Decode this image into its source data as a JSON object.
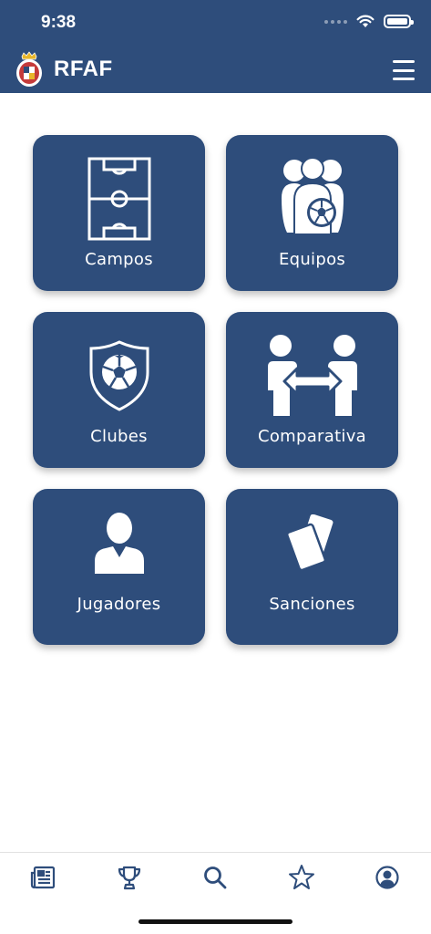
{
  "status_bar": {
    "time": "9:38"
  },
  "header": {
    "title": "RFAF",
    "logo_icon": "federation-crest-icon",
    "menu_icon": "hamburger-menu-icon"
  },
  "tiles": [
    {
      "label": "Campos",
      "icon": "football-pitch-icon"
    },
    {
      "label": "Equipos",
      "icon": "team-players-icon"
    },
    {
      "label": "Clubes",
      "icon": "shield-ball-icon"
    },
    {
      "label": "Comparativa",
      "icon": "compare-players-icon"
    },
    {
      "label": "Jugadores",
      "icon": "player-icon"
    },
    {
      "label": "Sanciones",
      "icon": "penalty-cards-icon"
    }
  ],
  "tabbar": [
    {
      "icon": "news-icon"
    },
    {
      "icon": "trophy-icon"
    },
    {
      "icon": "search-icon"
    },
    {
      "icon": "star-icon"
    },
    {
      "icon": "user-profile-icon"
    }
  ],
  "colors": {
    "primary": "#2e4d7b",
    "background": "#ffffff",
    "text_on_primary": "#ffffff"
  }
}
